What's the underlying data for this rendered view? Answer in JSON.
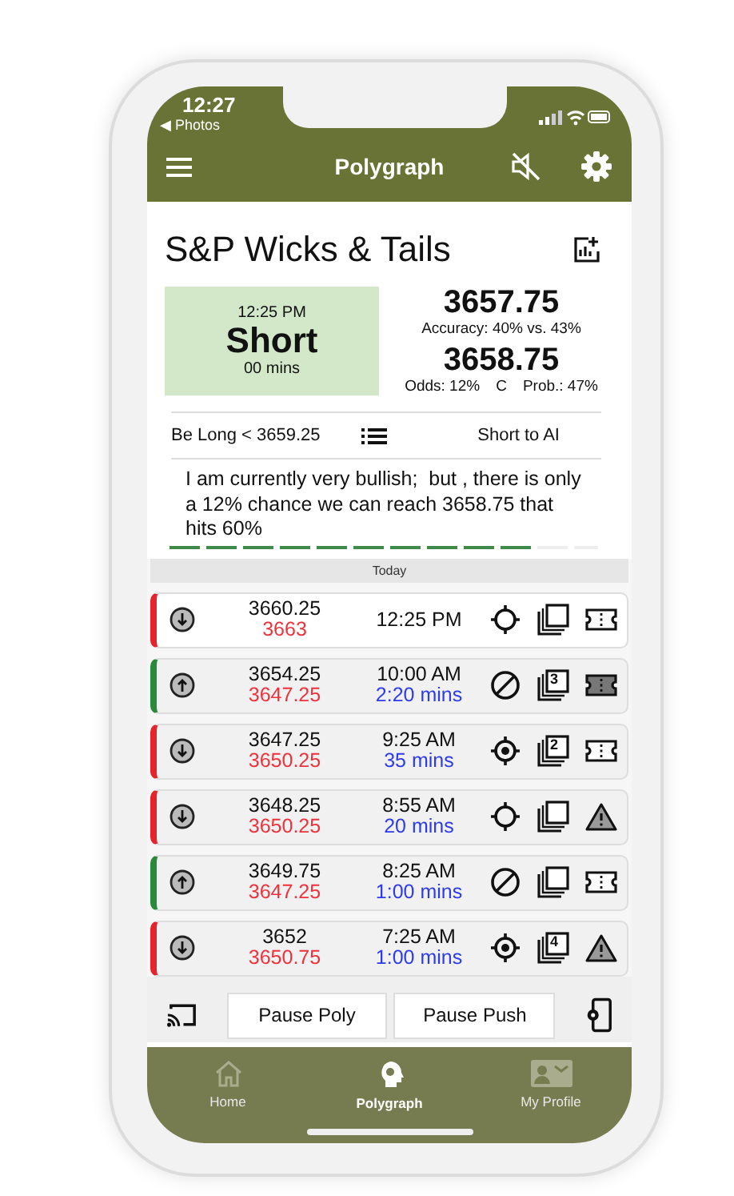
{
  "status_bar": {
    "time": "12:27",
    "back_label": "◀ Photos"
  },
  "nav_bar": {
    "title": "Polygraph",
    "muted": true
  },
  "title": "S&P Wicks & Tails",
  "signal": {
    "time": "12:25 PM",
    "call": "Short",
    "duration": "00 mins"
  },
  "stats": {
    "price": "3657.75",
    "accuracy": "Accuracy: 40% vs. 43%",
    "target": "3658.75",
    "odds": "Odds: 12%",
    "grade": "C",
    "probability": "Prob.: 47%"
  },
  "info_row": {
    "left": "Be Long < 3659.25",
    "right": "Short to AI"
  },
  "message": "I am currently very bullish;  but , there is only a 12% chance we can reach 3658.75 that hits 60%",
  "progress": {
    "level": 0.85
  },
  "day_header": "Today",
  "trades": [
    {
      "kind": "short",
      "selected": true,
      "price": "3660.25",
      "stop": "3663",
      "time": "12:25 PM",
      "blocked": false,
      "target_hit": false,
      "ticket_filled": false,
      "warning": false
    },
    {
      "kind": "long",
      "selected": false,
      "price": "3654.25",
      "stop": "3647.25",
      "time": "10:00 AM",
      "duration": "2:20 mins",
      "blocked": true,
      "target_hit": false,
      "stack": "3",
      "ticket_filled": true,
      "warning": false
    },
    {
      "kind": "short",
      "selected": false,
      "price": "3647.25",
      "stop": "3650.25",
      "time": "9:25 AM",
      "duration": "35 mins",
      "blocked": false,
      "target_hit": true,
      "stack": "2",
      "ticket_filled": false,
      "warning": false
    },
    {
      "kind": "short",
      "selected": false,
      "price": "3648.25",
      "stop": "3650.25",
      "time": "8:55 AM",
      "duration": "20 mins",
      "blocked": false,
      "target_hit": false,
      "ticket_filled": false,
      "warning": true
    },
    {
      "kind": "long",
      "selected": false,
      "price": "3649.75",
      "stop": "3647.25",
      "time": "8:25 AM",
      "duration": "1:00 mins",
      "blocked": true,
      "target_hit": false,
      "ticket_filled": false,
      "warning": false
    },
    {
      "kind": "short",
      "selected": false,
      "price": "3652",
      "stop": "3650.75",
      "time": "7:25 AM",
      "duration": "1:00 mins",
      "blocked": false,
      "target_hit": true,
      "stack": "4",
      "ticket_filled": false,
      "warning": true
    }
  ],
  "buttons": [
    "Pause Poly",
    "Pause Push"
  ],
  "tabs": [
    {
      "label": "Home",
      "selected": false
    },
    {
      "label": "Polygraph",
      "selected": true
    },
    {
      "label": "My Profile",
      "selected": false
    }
  ]
}
